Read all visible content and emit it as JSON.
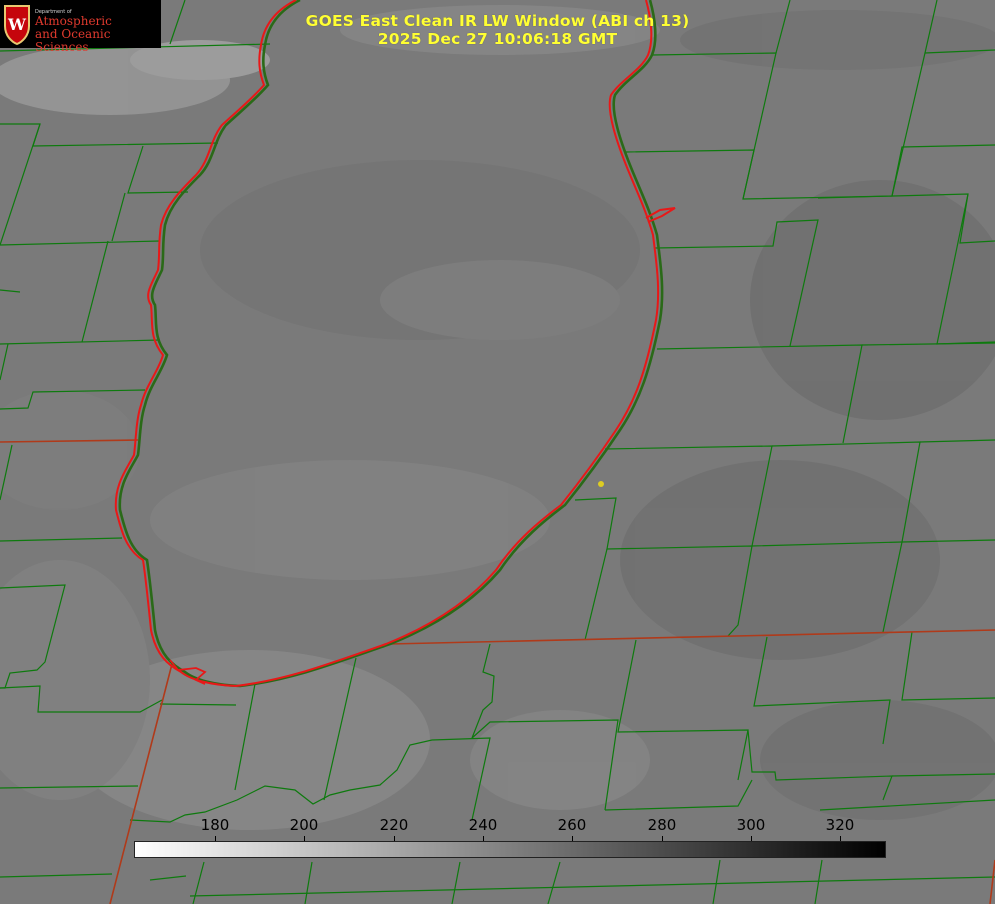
{
  "logo": {
    "department": "Department of",
    "line1": "Atmospheric",
    "line2": "and Oceanic Sciences",
    "seal_letter": "W"
  },
  "title": {
    "line1": "GOES East Clean IR LW Window (ABI ch 13)",
    "line2": "2025 Dec 27 10:06:18 GMT"
  },
  "colorbar": {
    "ticks": [
      "180",
      "200",
      "220",
      "240",
      "260",
      "280",
      "300",
      "320"
    ],
    "gradient": [
      "#ffffff",
      "#000000"
    ]
  },
  "colors": {
    "background": "#7a7a7a",
    "county_lines": "#0e7a0e",
    "lake_shoreline": "#e81818",
    "state_lines": "#b03a1a",
    "marker": "#ddcc22",
    "title_text": "#ffff33"
  }
}
